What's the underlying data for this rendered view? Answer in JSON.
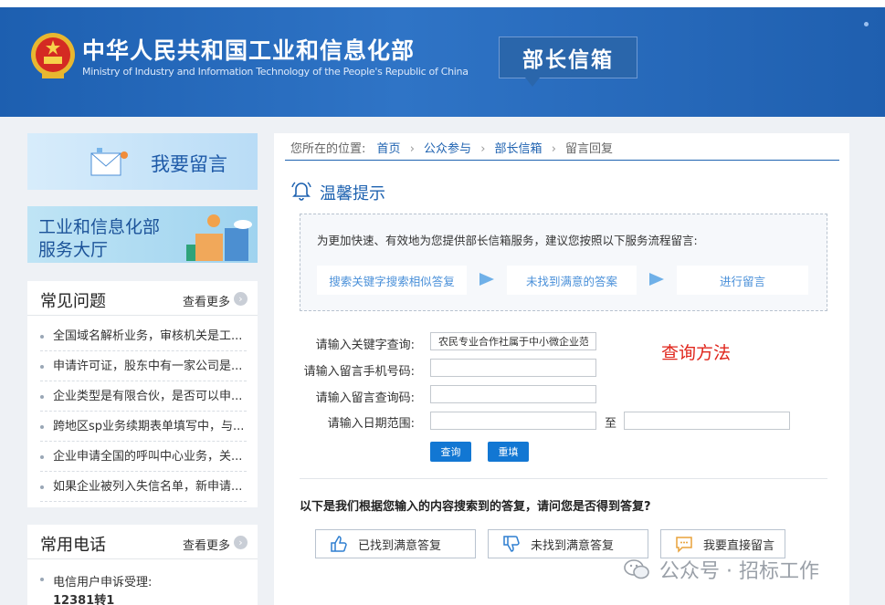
{
  "header": {
    "title_cn": "中华人民共和国工业和信息化部",
    "title_en": "Ministry of Industry and Information Technology of the People's Republic of China",
    "badge": "部长信箱",
    "brand_color": "#1d5fb0"
  },
  "sidebar": {
    "leave_message_banner": "我要留言",
    "service_hall_line1": "工业和信息化部",
    "service_hall_line2": "服务大厅",
    "faq": {
      "title": "常见问题",
      "more": "查看更多",
      "items": [
        "全国域名解析业务，审核机关是工...",
        "申请许可证，股东中有一家公司是...",
        "企业类型是有限合伙，是否可以申...",
        "跨地区sp业务续期表单填写中，与...",
        "企业申请全国的呼叫中心业务，关...",
        "如果企业被列入失信名单，新申请..."
      ]
    },
    "phones": {
      "title": "常用电话",
      "more": "查看更多",
      "item_label": "电信用户申诉受理:",
      "item_number": "12381转1"
    }
  },
  "breadcrumb": {
    "prefix": "您所在的位置:",
    "items": [
      "首页",
      "公众参与",
      "部长信箱",
      "留言回复"
    ]
  },
  "tips": {
    "title": "温馨提示",
    "text": "为更加快速、有效地为您提供部长信箱服务，建议您按照以下服务流程留言:",
    "steps": [
      "搜索关键字搜索相似答复",
      "未找到满意的答案",
      "进行留言"
    ]
  },
  "form": {
    "keyword_label": "请输入关键字查询:",
    "keyword_value": "农民专业合作社属于中小微企业范",
    "phone_label": "请输入留言手机号码:",
    "phone_value": "",
    "code_label": "请输入留言查询码:",
    "code_value": "",
    "date_label": "请输入日期范围:",
    "date_from": "",
    "date_sep": "至",
    "date_to": "",
    "search_button": "查询",
    "reset_button": "重填"
  },
  "annotation": {
    "text": "查询方法",
    "color": "#e0261c"
  },
  "feedback": {
    "question": "以下是我们根据您输入的内容搜索到的答复，请问您是否得到答复?",
    "found": "已找到满意答复",
    "not_found": "未找到满意答复",
    "direct": "我要直接留言"
  },
  "watermark": {
    "text": "公众号 · 招标工作"
  }
}
